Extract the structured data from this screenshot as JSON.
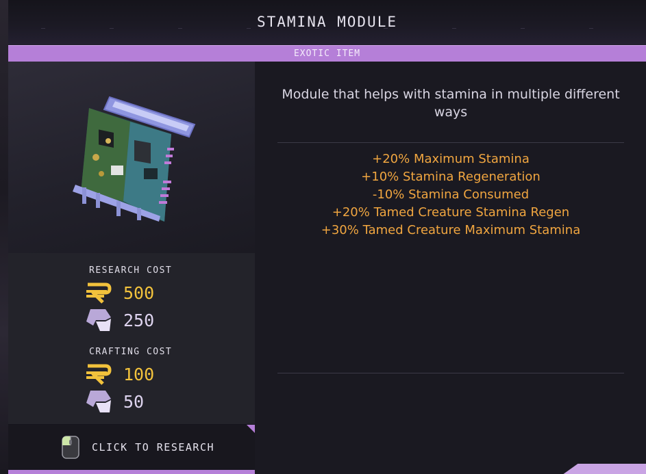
{
  "item": {
    "name": "STAMINA MODULE",
    "rarity": "EXOTIC ITEM",
    "description": "Module that helps with stamina in multiple different ways",
    "stats": [
      "+20% Maximum Stamina",
      "+10% Stamina Regeneration",
      "-10% Stamina Consumed",
      "+20% Tamed Creature Stamina Regen",
      "+30% Tamed Creature Maximum Stamina"
    ]
  },
  "research_cost": {
    "heading": "RESEARCH COST",
    "credits": "500",
    "resources": "250"
  },
  "crafting_cost": {
    "heading": "CRAFTING COST",
    "credits": "100",
    "resources": "50"
  },
  "action": {
    "label": "CLICK TO RESEARCH"
  },
  "icons": {
    "credits": "credits-currency-icon",
    "resources": "research-resource-icon",
    "mouse": "mouse-left-click-icon",
    "item": "stamina-module-item-image"
  },
  "colors": {
    "rarity_accent": "#b57fd8",
    "stat_text": "#f1a640",
    "credits": "#f2c23c"
  }
}
